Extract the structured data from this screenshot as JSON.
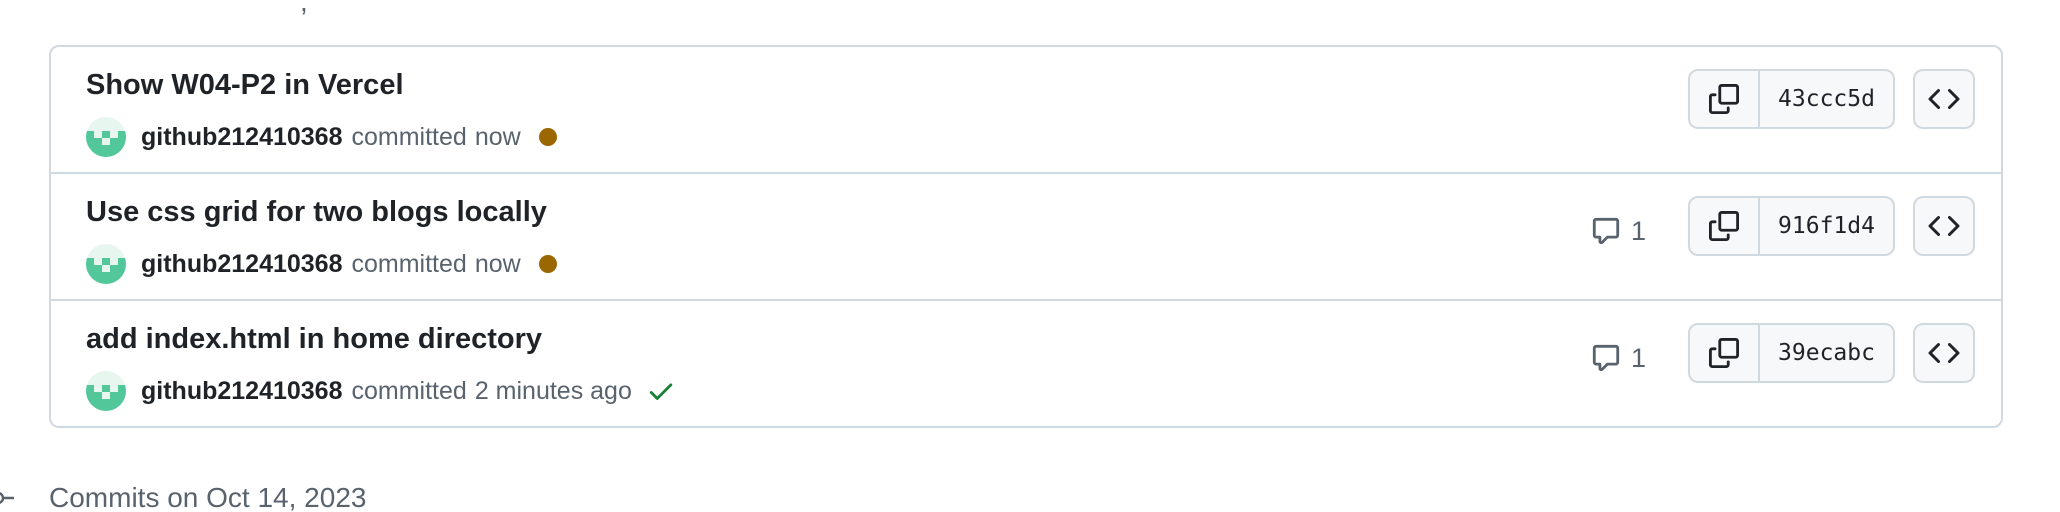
{
  "commits": [
    {
      "title": "Show W04-P2 in Vercel",
      "author": "github212410368",
      "action": "committed",
      "time": "now",
      "status": "pending",
      "comments": "",
      "sha": "43ccc5d"
    },
    {
      "title": "Use css grid for two blogs locally",
      "author": "github212410368",
      "action": "committed",
      "time": "now",
      "status": "pending",
      "comments": "1",
      "sha": "916f1d4"
    },
    {
      "title": "add index.html in home directory",
      "author": "github212410368",
      "action": "committed",
      "time": "2 minutes ago",
      "status": "success",
      "comments": "1",
      "sha": "39ecabc"
    }
  ],
  "date_header": {
    "label": "Commits on Oct 14, 2023"
  },
  "icons": {
    "copy": "copy-icon",
    "browse": "code-icon",
    "comment": "comment-icon",
    "timeline": "git-commit-icon",
    "pending": "dot-fill-icon",
    "success": "check-icon"
  },
  "colors": {
    "pending": "#9a6700",
    "success": "#1a7f37",
    "muted_text": "#59636e",
    "border": "#d1d9e0",
    "avatar": "#4fc08d"
  }
}
